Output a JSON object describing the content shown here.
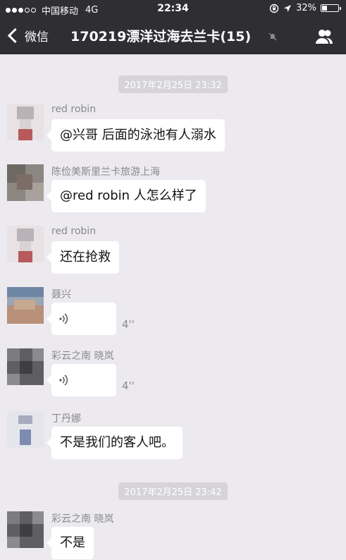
{
  "status": {
    "carrier": "中国移动",
    "network": "4G",
    "time": "22:34",
    "battery_text": "32%",
    "battery_level": 0.32
  },
  "nav": {
    "back_label": "微信",
    "title": "170219漂洋过海去兰卡(15)"
  },
  "timestamps": [
    "2017年2月25日 23:32",
    "2017年2月25日 23:42"
  ],
  "messages": [
    {
      "sender": "red robin",
      "text": "@兴哥 后面的泳池有人溺水",
      "type": "text"
    },
    {
      "sender": "陈俭美斯里兰卡旅游上海",
      "text": "@red robin 人怎么样了",
      "type": "text"
    },
    {
      "sender": "red robin",
      "text": "还在抢救",
      "type": "text"
    },
    {
      "sender": "聂兴",
      "duration": "4''",
      "type": "voice"
    },
    {
      "sender": "彩云之南 晓岚",
      "duration": "4''",
      "type": "voice"
    },
    {
      "sender": "丁丹娜",
      "text": "不是我们的客人吧。",
      "type": "text"
    },
    {
      "sender": "彩云之南 晓岚",
      "text": "不是",
      "type": "text"
    }
  ],
  "colors": {
    "bar": "#2e2e33",
    "background": "#eceaef",
    "bubble": "#ffffff"
  }
}
